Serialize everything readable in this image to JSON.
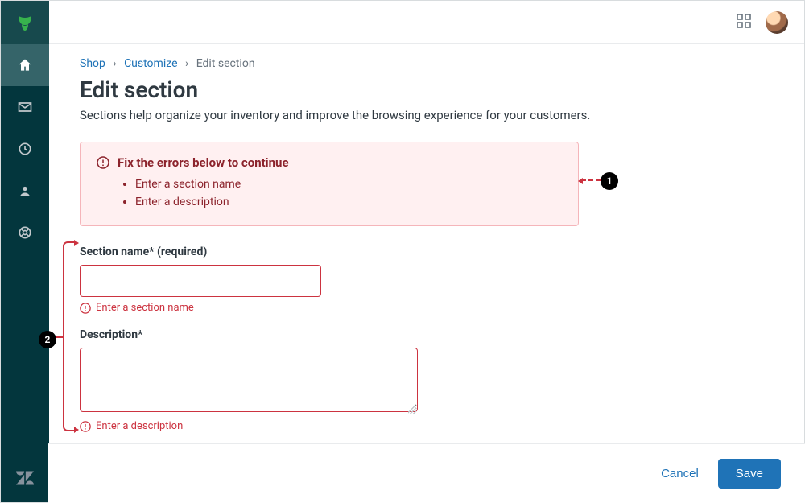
{
  "sidebar": {
    "items": [
      {
        "name": "home"
      },
      {
        "name": "mail"
      },
      {
        "name": "clock"
      },
      {
        "name": "user"
      },
      {
        "name": "lifesaver"
      }
    ]
  },
  "breadcrumb": {
    "shop": "Shop",
    "customize": "Customize",
    "current": "Edit section"
  },
  "page": {
    "title": "Edit section",
    "subtitle": "Sections help organize your inventory and improve the browsing experience for your customers."
  },
  "error_banner": {
    "title": "Fix the errors below to continue",
    "items": [
      "Enter a section name",
      "Enter a description"
    ]
  },
  "form": {
    "section_name": {
      "label": "Section name* (required)",
      "value": "",
      "error": "Enter a section name"
    },
    "description": {
      "label": "Description*",
      "value": "",
      "error": "Enter a description"
    }
  },
  "footer": {
    "cancel": "Cancel",
    "save": "Save"
  },
  "callouts": {
    "one": "1",
    "two": "2"
  }
}
